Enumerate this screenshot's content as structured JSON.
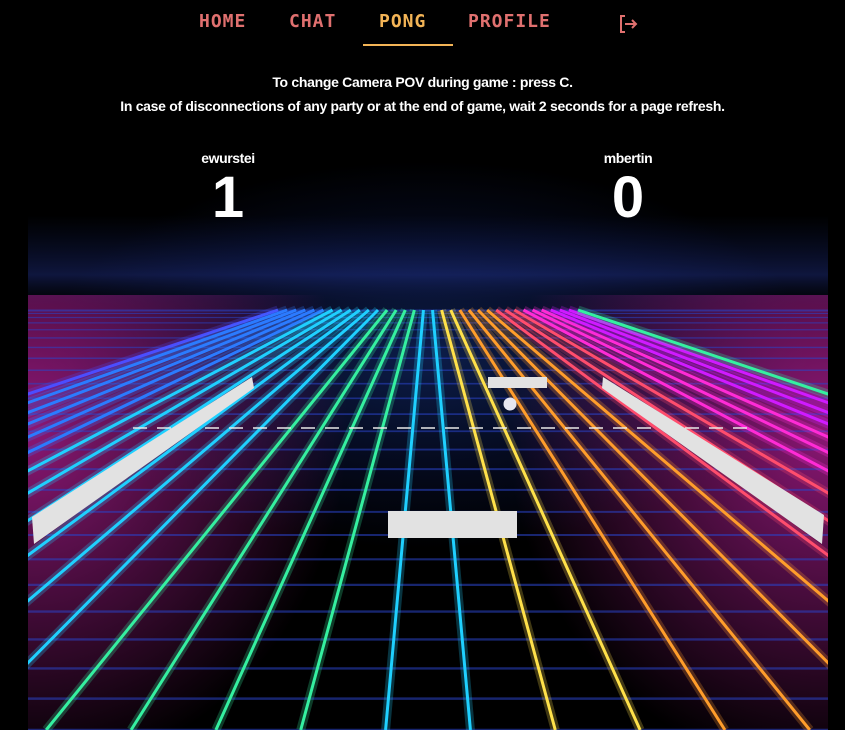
{
  "nav": {
    "items": [
      {
        "label": "HOME",
        "active": false
      },
      {
        "label": "CHAT",
        "active": false
      },
      {
        "label": "PONG",
        "active": true
      },
      {
        "label": "PROFILE",
        "active": false
      }
    ],
    "logout_icon": "logout-icon",
    "colors": {
      "default": "#e0706f",
      "active": "#f3b456"
    }
  },
  "info": {
    "line1": "To change Camera POV during game : press C.",
    "line2": "In case of disconnections of any party or at the end of game, wait 2 seconds for a page refresh."
  },
  "game": {
    "player_left": {
      "name": "ewurstei",
      "score": "1"
    },
    "player_right": {
      "name": "mbertin",
      "score": "0"
    },
    "paddle_color": "#e2e2e2",
    "ball_color": "#e6e6ef"
  }
}
